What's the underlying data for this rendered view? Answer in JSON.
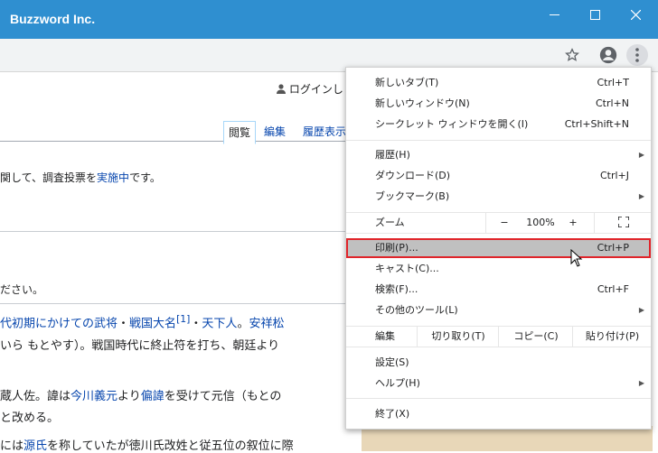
{
  "window": {
    "title": "Buzzword Inc.",
    "minimize": "—",
    "maximize": "☐",
    "close": "✕"
  },
  "toolbar": {
    "bookmark_icon": "star-icon",
    "profile_icon": "account-icon",
    "menu_icon": "kebab-icon"
  },
  "page": {
    "login": "ログインし",
    "tabs": [
      {
        "label": "閲覧"
      },
      {
        "label": "編集"
      },
      {
        "label": "履歴表示"
      }
    ],
    "notice": {
      "text": "関して、調査投票を",
      "link": "実施中",
      "suffix": "です。"
    },
    "line_please": "ださい。",
    "lines": [
      {
        "pre": "",
        "link1": "代初期にかけての",
        "link2": "武将",
        "mid": "・",
        "link3": "戦国大名",
        "sup": "[1]",
        "mid2": "・",
        "link4": "天下人",
        "tail": "。",
        "link5": "安祥松"
      },
      {
        "text": "いら もとやす）。戦国時代に終止符を打ち、朝廷より"
      },
      {
        "pre": "蔵人佐。諱は",
        "link1": "今川義元",
        "mid": "より",
        "link2": "偏諱",
        "tail": "を受けて元信（もとの"
      },
      {
        "text": "と改める。"
      },
      {
        "pre": "には",
        "link1": "源氏",
        "tail": "を称していたが徳川氏改姓と従五位の叙位に際"
      }
    ]
  },
  "menu": {
    "items": [
      {
        "label": "新しいタブ(T)",
        "shortcut": "Ctrl+T"
      },
      {
        "label": "新しいウィンドウ(N)",
        "shortcut": "Ctrl+N"
      },
      {
        "label": "シークレット ウィンドウを開く(I)",
        "shortcut": "Ctrl+Shift+N"
      },
      {
        "label": "履歴(H)",
        "shortcut": ""
      },
      {
        "label": "ダウンロード(D)",
        "shortcut": "Ctrl+J"
      },
      {
        "label": "ブックマーク(B)",
        "shortcut": ""
      },
      {
        "label": "印刷(P)...",
        "shortcut": "Ctrl+P"
      },
      {
        "label": "キャスト(C)...",
        "shortcut": ""
      },
      {
        "label": "検索(F)...",
        "shortcut": "Ctrl+F"
      },
      {
        "label": "その他のツール(L)",
        "shortcut": ""
      },
      {
        "label": "設定(S)",
        "shortcut": ""
      },
      {
        "label": "ヘルプ(H)",
        "shortcut": ""
      },
      {
        "label": "終了(X)",
        "shortcut": ""
      }
    ],
    "zoom": {
      "label": "ズーム",
      "minus": "−",
      "value": "100%",
      "plus": "+"
    },
    "edit": {
      "label": "編集",
      "cut": "切り取り(T)",
      "copy": "コピー(C)",
      "paste": "貼り付け(P)"
    }
  }
}
